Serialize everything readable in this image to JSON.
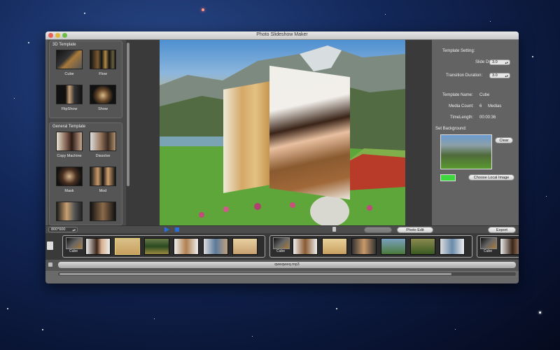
{
  "window": {
    "title": "Photo Slideshow Maker"
  },
  "left": {
    "section_3d": {
      "title": "3D Template",
      "items": [
        {
          "label": "Cube"
        },
        {
          "label": "Flow"
        },
        {
          "label": "FlipShow"
        },
        {
          "label": "Show"
        }
      ]
    },
    "section_general": {
      "title": "General Template",
      "items": [
        {
          "label": "Copy Machine"
        },
        {
          "label": "Dissolve"
        },
        {
          "label": "Mask"
        },
        {
          "label": "Mod"
        }
      ]
    }
  },
  "right": {
    "template_setting_title": "Template Setting:",
    "slide_duration_label": "Slide Duration:",
    "slide_duration_value": "3.0",
    "transition_duration_label": "Transition Duration:",
    "transition_duration_value": "3.0",
    "template_name_label": "Template Name:",
    "template_name_value": "Cube",
    "media_count_label": "Media Count:",
    "media_count_value": "6",
    "media_count_unit": "Medias",
    "time_length_label": "TimeLength:",
    "time_length_value": "00:00:36",
    "set_background_label": "Set Background:",
    "clear_button": "Clear",
    "choose_local_image_button": "Choose Local Image",
    "background_color": "#3dd63d"
  },
  "toolbar": {
    "resolution": "800*600",
    "photo_edit_button": "Photo Edit",
    "export_button": "Export"
  },
  "timeline": {
    "template_label": "Cube"
  },
  "audio": {
    "filename": "qweqweq.mp3"
  },
  "colors": {
    "window_bg": "#5a5a5a",
    "play_blue": "#2a6fd8"
  }
}
